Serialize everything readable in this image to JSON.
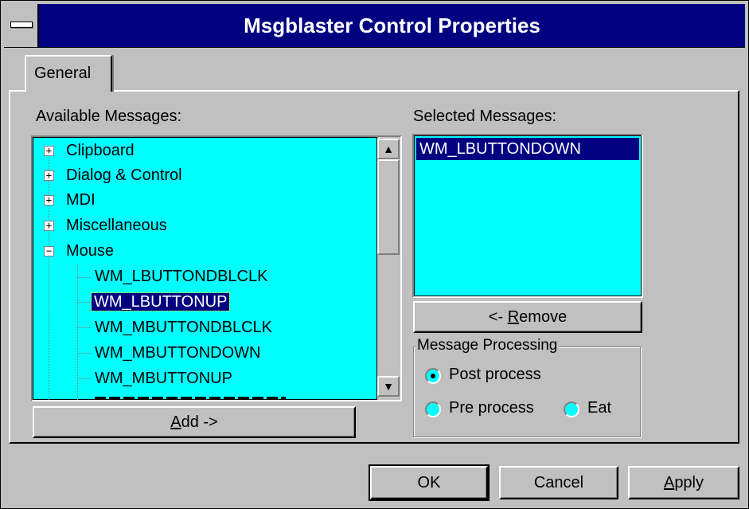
{
  "window": {
    "title": "Msgblaster Control Properties"
  },
  "tabs": [
    {
      "label": "General"
    }
  ],
  "available": {
    "label": "Available Messages:",
    "groups": [
      {
        "label": "Clipboard",
        "expander": "+"
      },
      {
        "label": "Dialog & Control",
        "expander": "+"
      },
      {
        "label": "MDI",
        "expander": "+"
      },
      {
        "label": "Miscellaneous",
        "expander": "+"
      },
      {
        "label": "Mouse",
        "expander": "−"
      }
    ],
    "children": [
      "WM_LBUTTONDBLCLK",
      "WM_LBUTTONUP",
      "WM_MBUTTONDBLCLK",
      "WM_MBUTTONDOWN",
      "WM_MBUTTONUP"
    ],
    "selected_child": "WM_LBUTTONUP",
    "add_button": {
      "prefix": "A",
      "rest": "dd ->"
    }
  },
  "selected": {
    "label": "Selected Messages:",
    "items": [
      "WM_LBUTTONDOWN"
    ],
    "remove_button": {
      "prefix": "<- ",
      "accel": "R",
      "rest": "emove"
    }
  },
  "processing": {
    "title": "Message Processing",
    "options": [
      {
        "label": "Post process",
        "checked": true
      },
      {
        "label": "Pre process",
        "checked": false
      },
      {
        "label": "Eat",
        "checked": false
      }
    ]
  },
  "buttons": {
    "ok": "OK",
    "cancel": "Cancel",
    "apply_accel": "A",
    "apply_rest": "pply"
  },
  "colors": {
    "titlebar": "#000080",
    "list_background": "#00ffff",
    "selection": "#000080",
    "face": "#c0c0c0"
  }
}
